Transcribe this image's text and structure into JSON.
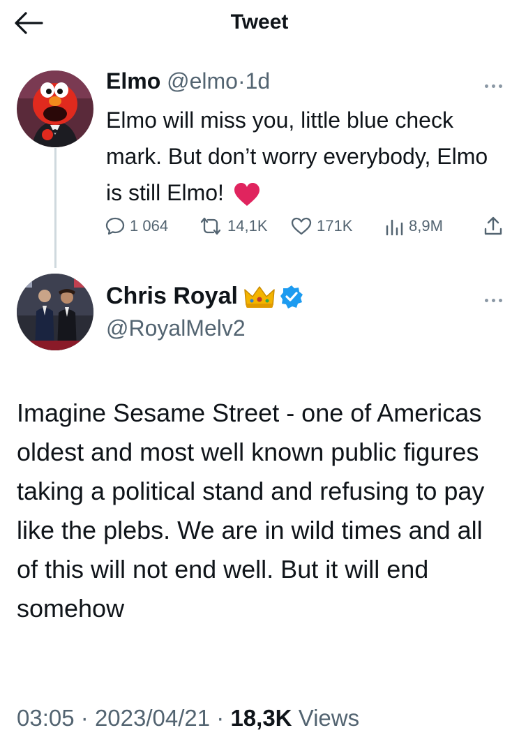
{
  "header": {
    "title": "Tweet"
  },
  "quoted_tweet": {
    "name": "Elmo",
    "handle": "@elmo",
    "separator": "·",
    "time": "1d",
    "text": "Elmo will miss you, little blue check mark. But don’t worry everybody, Elmo is still Elmo!",
    "emoji": "red-heart",
    "stats": {
      "replies": "1 064",
      "retweets": "14,1K",
      "likes": "171K",
      "views": "8,9M"
    }
  },
  "main_tweet": {
    "name": "Chris Royal",
    "badge_emoji": "crown",
    "verified": true,
    "handle": "@RoyalMelv2",
    "text": "Imagine Sesame Street - one of Americas oldest and most well known public figures taking a political stand and refusing to pay like the plebs.  We are in wild times and all of this will not end well. But it will end somehow",
    "time": "03:05",
    "date": "2023/04/21",
    "separator": "·",
    "views_count": "18,3K",
    "views_label": "Views"
  },
  "colors": {
    "accent": "#1d9bf0",
    "muted": "#536471",
    "text": "#0f1419",
    "heart": "#e0245e"
  }
}
